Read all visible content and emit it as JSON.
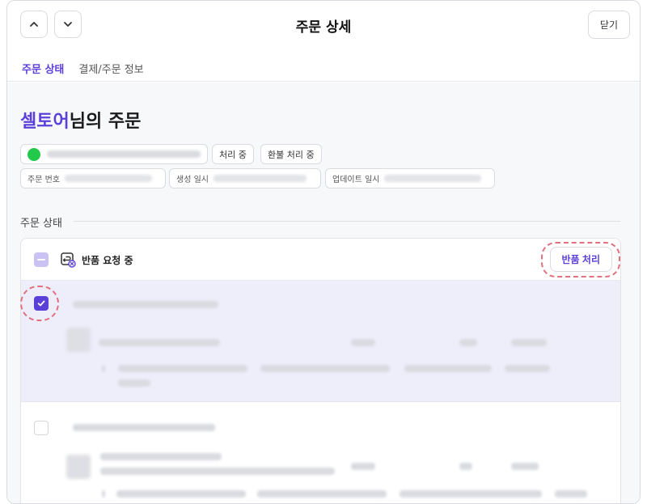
{
  "header": {
    "title": "주문 상세",
    "close_label": "닫기",
    "prev_icon": "chevron-up-icon",
    "next_icon": "chevron-down-icon"
  },
  "tabs": [
    {
      "label": "주문 상태",
      "active": true
    },
    {
      "label": "결제/주문 정보",
      "active": false
    }
  ],
  "order": {
    "customer_name": "셀토어",
    "heading_suffix": "님의 주문",
    "status_chips": [
      "처리 중",
      "환불 처리 중"
    ],
    "meta_labels": {
      "order_number": "주문 번호",
      "created_at": "생성 일시",
      "updated_at": "업데이트 일시"
    }
  },
  "section": {
    "title": "주문 상태"
  },
  "panel": {
    "status_label": "반품 요청 중",
    "action_button": "반품 처리"
  },
  "colors": {
    "accent": "#5b3fd9",
    "highlight_ring": "#e0727f",
    "selected_row": "#eeeefb"
  }
}
